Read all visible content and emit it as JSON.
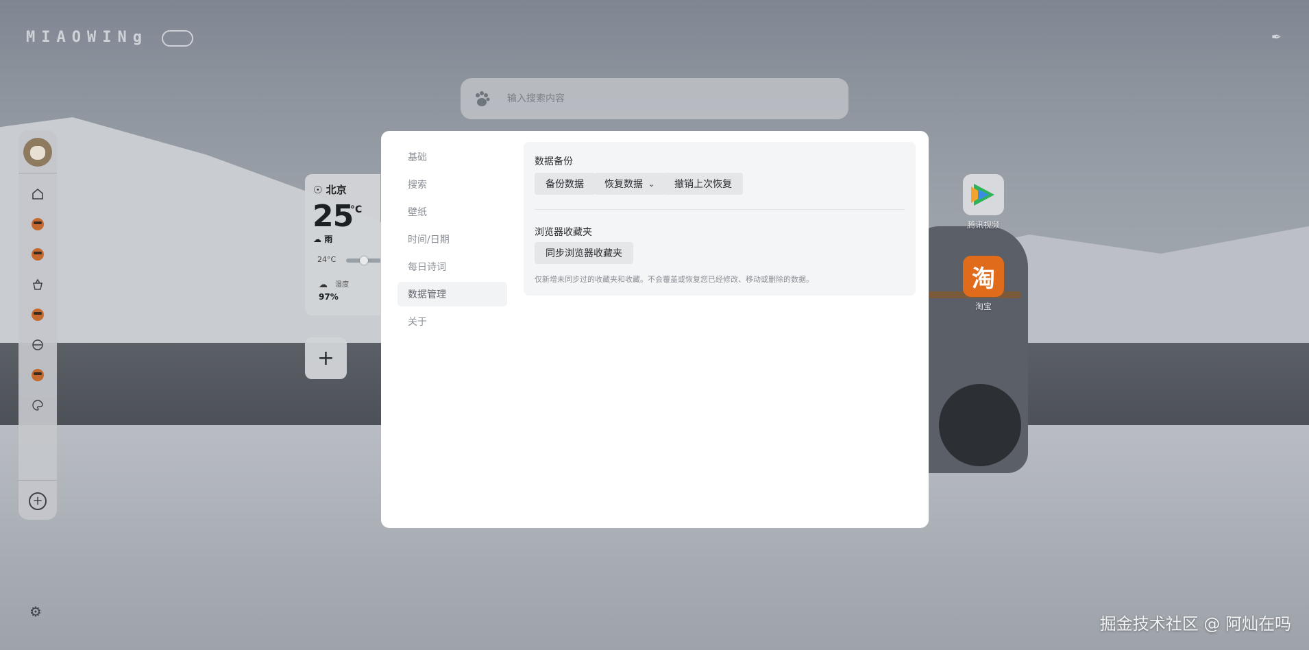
{
  "app": {
    "logo_text": "MIAOWINg",
    "watermark": "掘金技术社区 @ 阿灿在吗"
  },
  "search": {
    "placeholder": "输入搜索内容",
    "engine_icon": "baidu-paw-icon"
  },
  "sidebar": {
    "items": [
      {
        "icon": "home-icon"
      },
      {
        "icon": "face-icon"
      },
      {
        "icon": "face-icon"
      },
      {
        "icon": "basket-icon"
      },
      {
        "icon": "face-icon"
      },
      {
        "icon": "globe-icon"
      },
      {
        "icon": "face-icon"
      },
      {
        "icon": "palette-icon"
      }
    ],
    "add_icon": "plus-circle-icon",
    "settings_icon": "gear-icon"
  },
  "weather": {
    "city": "北京",
    "temperature": "25",
    "unit": "°C",
    "condition": "雨",
    "low": "24°C",
    "humidity_label": "湿度",
    "humidity_value": "97%"
  },
  "apps": [
    {
      "label": "腾讯视频",
      "icon": "tencent-video-icon"
    },
    {
      "label": "淘宝",
      "glyph": "淘",
      "color": "#e06b1b"
    }
  ],
  "modal": {
    "menu": [
      {
        "label": "基础"
      },
      {
        "label": "搜索"
      },
      {
        "label": "壁纸"
      },
      {
        "label": "时间/日期"
      },
      {
        "label": "每日诗词"
      },
      {
        "label": "数据管理",
        "active": true
      },
      {
        "label": "关于"
      }
    ],
    "backup": {
      "title": "数据备份",
      "backup_btn": "备份数据",
      "restore_btn": "恢复数据",
      "undo_btn": "撤销上次恢复"
    },
    "bookmarks": {
      "title": "浏览器收藏夹",
      "sync_btn": "同步浏览器收藏夹",
      "note": "仅新增未同步过的收藏夹和收藏。不会覆盖或恢复您已经修改、移动或删除的数据。"
    }
  }
}
